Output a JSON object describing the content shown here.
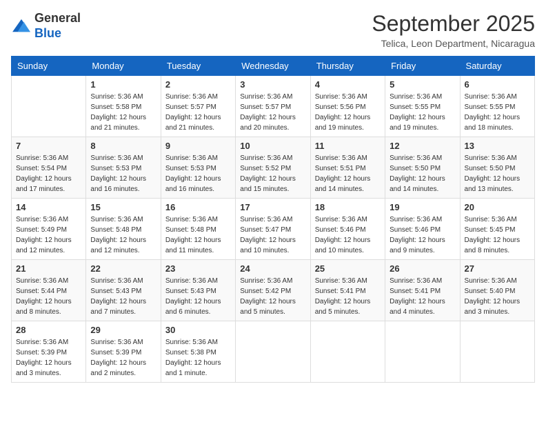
{
  "header": {
    "logo_line1": "General",
    "logo_line2": "Blue",
    "month_title": "September 2025",
    "location": "Telica, Leon Department, Nicaragua"
  },
  "weekdays": [
    "Sunday",
    "Monday",
    "Tuesday",
    "Wednesday",
    "Thursday",
    "Friday",
    "Saturday"
  ],
  "weeks": [
    [
      {
        "day": "",
        "info": ""
      },
      {
        "day": "1",
        "info": "Sunrise: 5:36 AM\nSunset: 5:58 PM\nDaylight: 12 hours\nand 21 minutes."
      },
      {
        "day": "2",
        "info": "Sunrise: 5:36 AM\nSunset: 5:57 PM\nDaylight: 12 hours\nand 21 minutes."
      },
      {
        "day": "3",
        "info": "Sunrise: 5:36 AM\nSunset: 5:57 PM\nDaylight: 12 hours\nand 20 minutes."
      },
      {
        "day": "4",
        "info": "Sunrise: 5:36 AM\nSunset: 5:56 PM\nDaylight: 12 hours\nand 19 minutes."
      },
      {
        "day": "5",
        "info": "Sunrise: 5:36 AM\nSunset: 5:55 PM\nDaylight: 12 hours\nand 19 minutes."
      },
      {
        "day": "6",
        "info": "Sunrise: 5:36 AM\nSunset: 5:55 PM\nDaylight: 12 hours\nand 18 minutes."
      }
    ],
    [
      {
        "day": "7",
        "info": "Sunrise: 5:36 AM\nSunset: 5:54 PM\nDaylight: 12 hours\nand 17 minutes."
      },
      {
        "day": "8",
        "info": "Sunrise: 5:36 AM\nSunset: 5:53 PM\nDaylight: 12 hours\nand 16 minutes."
      },
      {
        "day": "9",
        "info": "Sunrise: 5:36 AM\nSunset: 5:53 PM\nDaylight: 12 hours\nand 16 minutes."
      },
      {
        "day": "10",
        "info": "Sunrise: 5:36 AM\nSunset: 5:52 PM\nDaylight: 12 hours\nand 15 minutes."
      },
      {
        "day": "11",
        "info": "Sunrise: 5:36 AM\nSunset: 5:51 PM\nDaylight: 12 hours\nand 14 minutes."
      },
      {
        "day": "12",
        "info": "Sunrise: 5:36 AM\nSunset: 5:50 PM\nDaylight: 12 hours\nand 14 minutes."
      },
      {
        "day": "13",
        "info": "Sunrise: 5:36 AM\nSunset: 5:50 PM\nDaylight: 12 hours\nand 13 minutes."
      }
    ],
    [
      {
        "day": "14",
        "info": "Sunrise: 5:36 AM\nSunset: 5:49 PM\nDaylight: 12 hours\nand 12 minutes."
      },
      {
        "day": "15",
        "info": "Sunrise: 5:36 AM\nSunset: 5:48 PM\nDaylight: 12 hours\nand 12 minutes."
      },
      {
        "day": "16",
        "info": "Sunrise: 5:36 AM\nSunset: 5:48 PM\nDaylight: 12 hours\nand 11 minutes."
      },
      {
        "day": "17",
        "info": "Sunrise: 5:36 AM\nSunset: 5:47 PM\nDaylight: 12 hours\nand 10 minutes."
      },
      {
        "day": "18",
        "info": "Sunrise: 5:36 AM\nSunset: 5:46 PM\nDaylight: 12 hours\nand 10 minutes."
      },
      {
        "day": "19",
        "info": "Sunrise: 5:36 AM\nSunset: 5:46 PM\nDaylight: 12 hours\nand 9 minutes."
      },
      {
        "day": "20",
        "info": "Sunrise: 5:36 AM\nSunset: 5:45 PM\nDaylight: 12 hours\nand 8 minutes."
      }
    ],
    [
      {
        "day": "21",
        "info": "Sunrise: 5:36 AM\nSunset: 5:44 PM\nDaylight: 12 hours\nand 8 minutes."
      },
      {
        "day": "22",
        "info": "Sunrise: 5:36 AM\nSunset: 5:43 PM\nDaylight: 12 hours\nand 7 minutes."
      },
      {
        "day": "23",
        "info": "Sunrise: 5:36 AM\nSunset: 5:43 PM\nDaylight: 12 hours\nand 6 minutes."
      },
      {
        "day": "24",
        "info": "Sunrise: 5:36 AM\nSunset: 5:42 PM\nDaylight: 12 hours\nand 5 minutes."
      },
      {
        "day": "25",
        "info": "Sunrise: 5:36 AM\nSunset: 5:41 PM\nDaylight: 12 hours\nand 5 minutes."
      },
      {
        "day": "26",
        "info": "Sunrise: 5:36 AM\nSunset: 5:41 PM\nDaylight: 12 hours\nand 4 minutes."
      },
      {
        "day": "27",
        "info": "Sunrise: 5:36 AM\nSunset: 5:40 PM\nDaylight: 12 hours\nand 3 minutes."
      }
    ],
    [
      {
        "day": "28",
        "info": "Sunrise: 5:36 AM\nSunset: 5:39 PM\nDaylight: 12 hours\nand 3 minutes."
      },
      {
        "day": "29",
        "info": "Sunrise: 5:36 AM\nSunset: 5:39 PM\nDaylight: 12 hours\nand 2 minutes."
      },
      {
        "day": "30",
        "info": "Sunrise: 5:36 AM\nSunset: 5:38 PM\nDaylight: 12 hours\nand 1 minute."
      },
      {
        "day": "",
        "info": ""
      },
      {
        "day": "",
        "info": ""
      },
      {
        "day": "",
        "info": ""
      },
      {
        "day": "",
        "info": ""
      }
    ]
  ]
}
